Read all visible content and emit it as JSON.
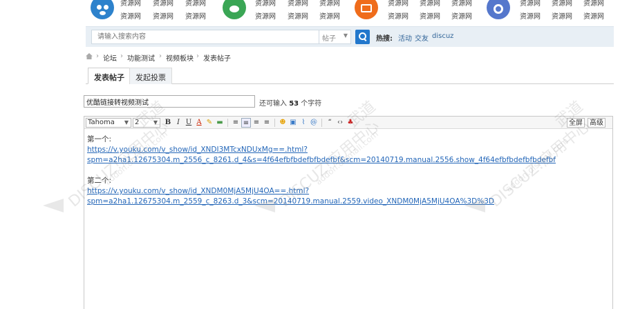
{
  "topnav": {
    "row1": [
      "资源网",
      "资源网",
      "资源网"
    ],
    "row2": [
      "资源网",
      "资源网",
      "资源网"
    ],
    "icon_colors": [
      "#2d82cc",
      "#3aa655",
      "#ef6c1b",
      "#5577cc"
    ]
  },
  "search": {
    "placeholder": "请输入搜索内容",
    "type_label": "帖子",
    "hot_label": "热搜:",
    "hot_links": [
      "活动",
      "交友",
      "discuz"
    ]
  },
  "breadcrumb": [
    "论坛",
    "功能测试",
    "视频板块",
    "发表帖子"
  ],
  "tabs": [
    {
      "label": "发表帖子",
      "active": true
    },
    {
      "label": "发起投票",
      "active": false
    }
  ],
  "subject": {
    "value": "优酷链接转视频测试",
    "hint_prefix": "还可输入",
    "hint_count": "53",
    "hint_suffix": "个字符"
  },
  "toolbar": {
    "font": "Tahoma",
    "size": "2",
    "fullscreen": "全屏",
    "advanced": "高级"
  },
  "content": {
    "label1": "第一个:",
    "url1_line1": "https://v.youku.com/v_show/id_XNDI3MTcxNDUxMg==.html?",
    "url1_line2": "spm=a2ha1.12675304.m_2556_c_8261.d_4&s=4f64efbfbdefbfbdefbf&scm=20140719.manual.2556.show_4f64efbfbdefbfbdefbf",
    "label2": "第二个:",
    "url2_line1": "https://v.youku.com/v_show/id_XNDM0MjA5MjU4OA==.html?",
    "url2_line2": "spm=a2ha1.12675304.m_2559_c_8263.d_3&scm=20140719.manual.2559.video_XNDM0MjA5MjU4OA%3D%3D"
  },
  "watermark": {
    "text1": "DISCUZ!应用中心",
    "text2": "addon.dismall.com",
    "text3": "武道"
  }
}
